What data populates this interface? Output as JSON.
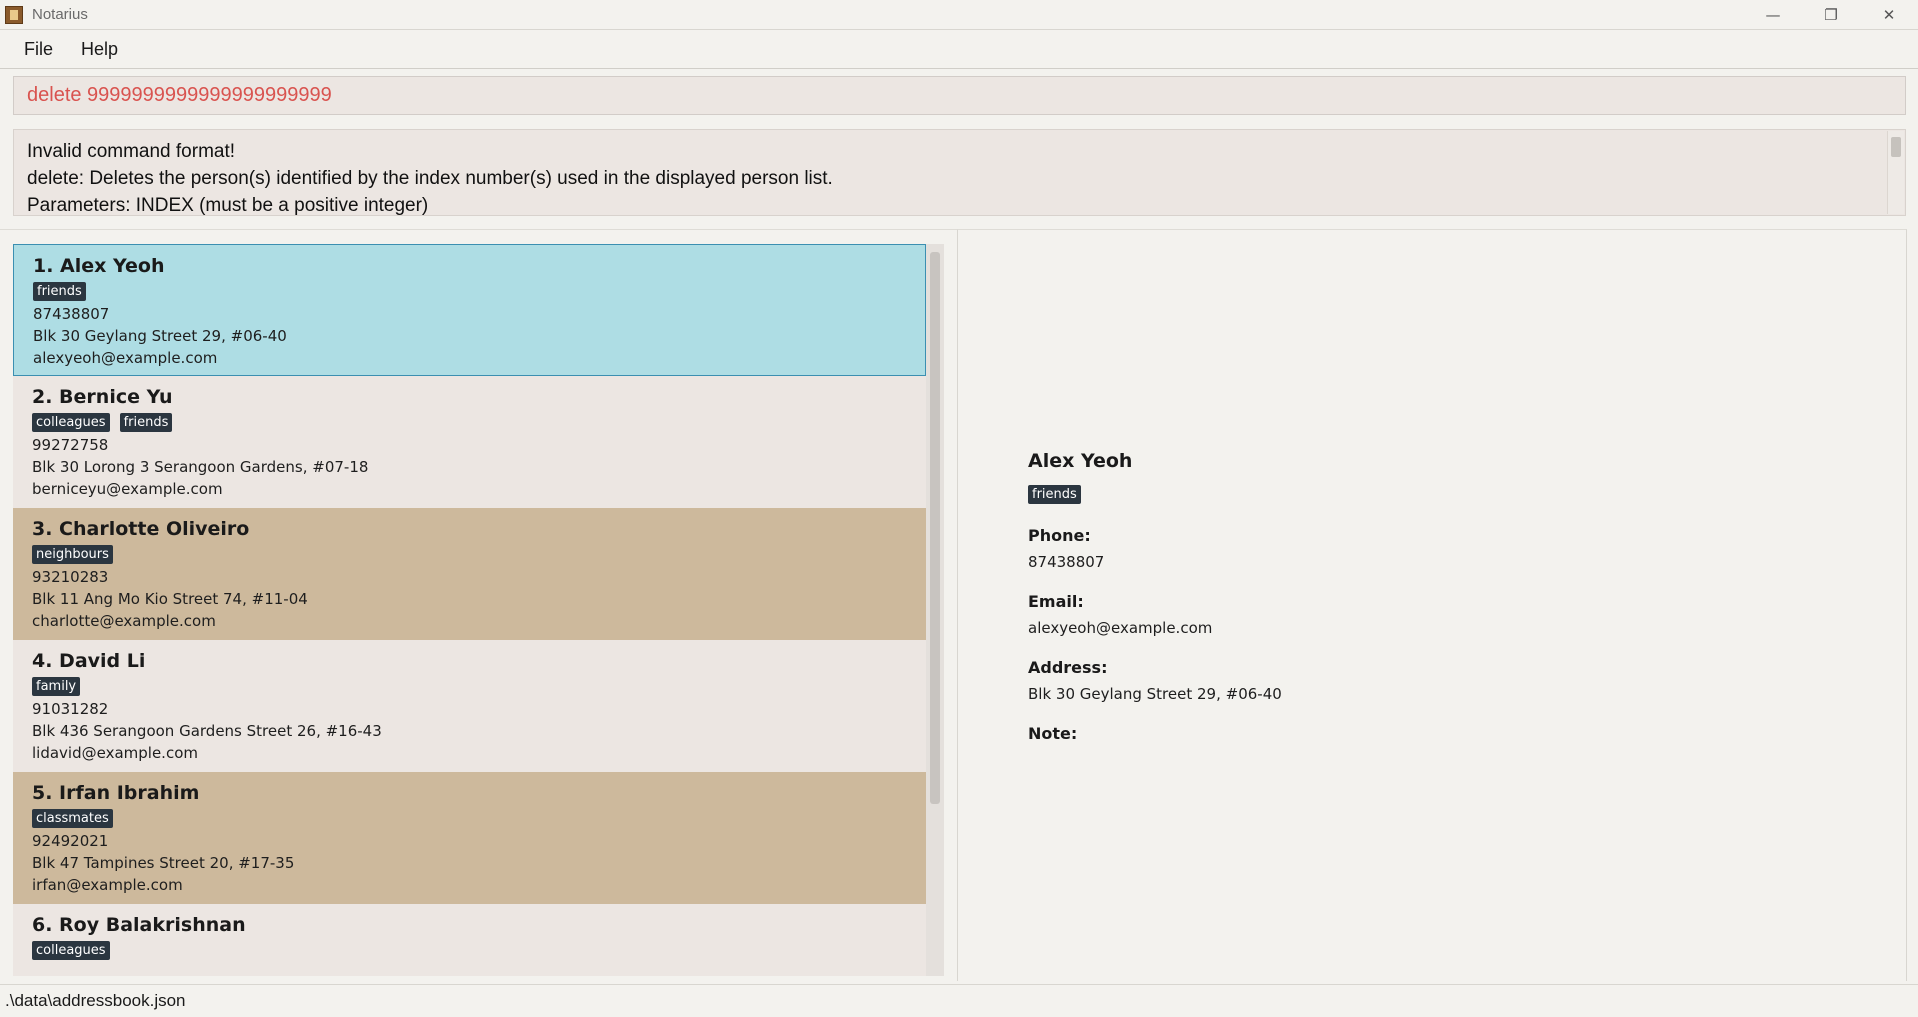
{
  "window": {
    "title": "Notarius",
    "minimize_glyph": "—",
    "maximize_glyph": "❐",
    "close_glyph": "✕"
  },
  "menu": {
    "file_label": "File",
    "help_label": "Help"
  },
  "command": {
    "value": "delete 9999999999999999999999",
    "text_color": "#d9534f"
  },
  "result": {
    "lines": [
      "Invalid command format!",
      "delete: Deletes the person(s) identified by the index number(s) used in the displayed person list.",
      "Parameters: INDEX (must be a positive integer)"
    ]
  },
  "persons": [
    {
      "index_name": "1. Alex Yeoh",
      "tags": [
        "friends"
      ],
      "phone": "87438807",
      "address": "Blk 30 Geylang Street 29, #06-40",
      "email": "alexyeoh@example.com",
      "selected": true
    },
    {
      "index_name": "2. Bernice Yu",
      "tags": [
        "colleagues",
        "friends"
      ],
      "phone": "99272758",
      "address": "Blk 30 Lorong 3 Serangoon Gardens, #07-18",
      "email": "berniceyu@example.com"
    },
    {
      "index_name": "3. Charlotte Oliveiro",
      "tags": [
        "neighbours"
      ],
      "phone": "93210283",
      "address": "Blk 11 Ang Mo Kio Street 74, #11-04",
      "email": "charlotte@example.com"
    },
    {
      "index_name": "4. David Li",
      "tags": [
        "family"
      ],
      "phone": "91031282",
      "address": "Blk 436 Serangoon Gardens Street 26, #16-43",
      "email": "lidavid@example.com"
    },
    {
      "index_name": "5. Irfan Ibrahim",
      "tags": [
        "classmates"
      ],
      "phone": "92492021",
      "address": "Blk 47 Tampines Street 20, #17-35",
      "email": "irfan@example.com"
    },
    {
      "index_name": "6. Roy Balakrishnan",
      "tags": [
        "colleagues"
      ],
      "phone": "",
      "address": "",
      "email": ""
    }
  ],
  "detail": {
    "name": "Alex Yeoh",
    "tags": [
      "friends"
    ],
    "phone_label": "Phone:",
    "phone": "87438807",
    "email_label": "Email:",
    "email": "alexyeoh@example.com",
    "address_label": "Address:",
    "address": "Blk 30 Geylang Street 29, #06-40",
    "note_label": "Note:"
  },
  "status": {
    "file_path": ".\\data\\addressbook.json"
  },
  "colors": {
    "selected_card": "#aedde4",
    "alt_card": "#cdb99c",
    "card": "#ece6e2",
    "tag": "#2b3640"
  }
}
